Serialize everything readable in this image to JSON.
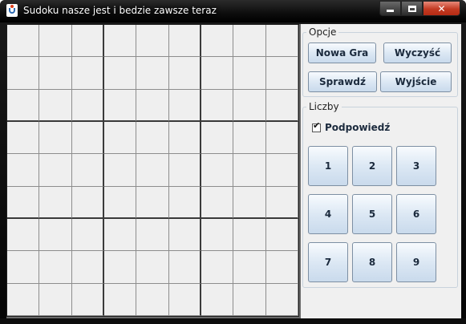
{
  "window": {
    "title": "Sudoku nasze jest i bedzie zawsze teraz",
    "controls": {
      "minimize": "minimize",
      "maximize": "maximize",
      "close": "✕"
    }
  },
  "board": {
    "rows": 9,
    "cols": 9
  },
  "options": {
    "legend": "Opcje",
    "new_game": "Nowa Gra",
    "clear": "Wyczyść",
    "check": "Sprawdź",
    "exit": "Wyjście"
  },
  "numbers": {
    "legend": "Liczby",
    "hint_label": "Podpowiedź",
    "hint_checked": true,
    "keys": [
      "1",
      "2",
      "3",
      "4",
      "5",
      "6",
      "7",
      "8",
      "9"
    ]
  }
}
